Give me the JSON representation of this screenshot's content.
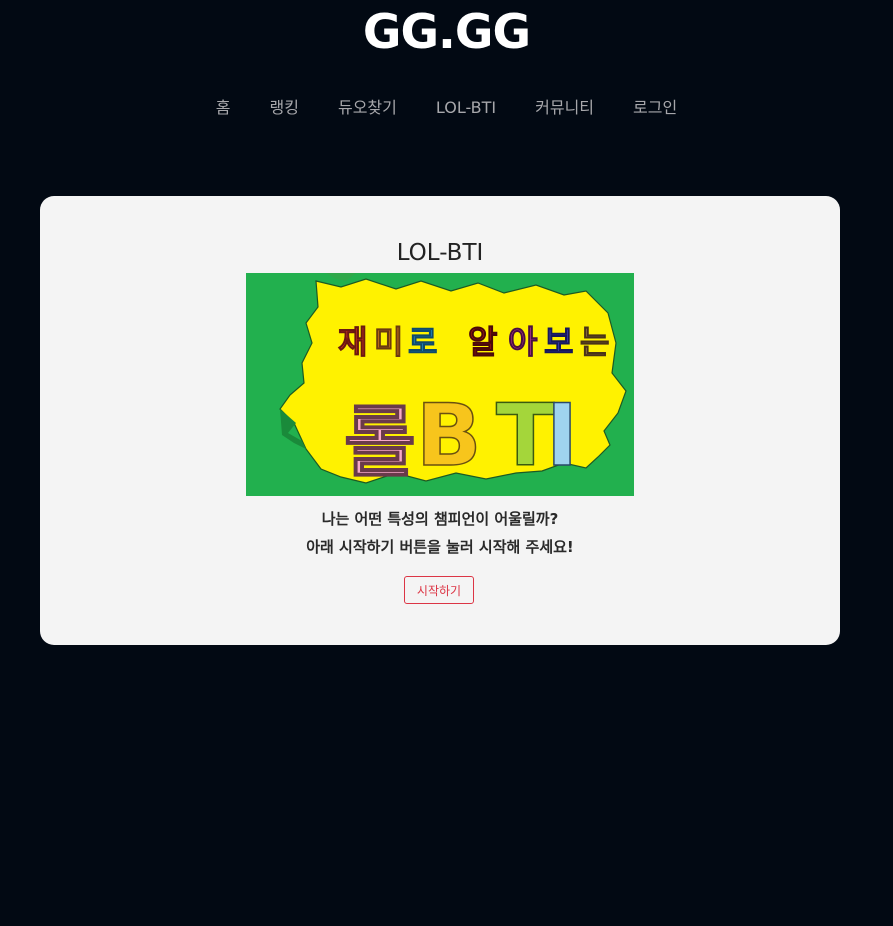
{
  "header": {
    "site_title": "GG.GG"
  },
  "nav": {
    "items": [
      {
        "label": "홈"
      },
      {
        "label": "랭킹"
      },
      {
        "label": "듀오찾기"
      },
      {
        "label": "LOL-BTI"
      },
      {
        "label": "커뮤니티"
      },
      {
        "label": "로그인"
      }
    ]
  },
  "main": {
    "title": "LOL-BTI",
    "banner": {
      "line1": "재미로 알아보는",
      "line2": "롤BTI",
      "colors": {
        "background": "#22b04e",
        "burst": "#fff200"
      }
    },
    "description_line1": "나는 어떤 특성의 챔피언이 어울릴까?",
    "description_line2": "아래 시작하기 버튼을 눌러 시작해 주세요!",
    "start_button": "시작하기"
  },
  "colors": {
    "page_background": "#020913",
    "card_background": "#f4f4f4",
    "accent": "#dc3545",
    "nav_text": "#a7a7ab"
  }
}
